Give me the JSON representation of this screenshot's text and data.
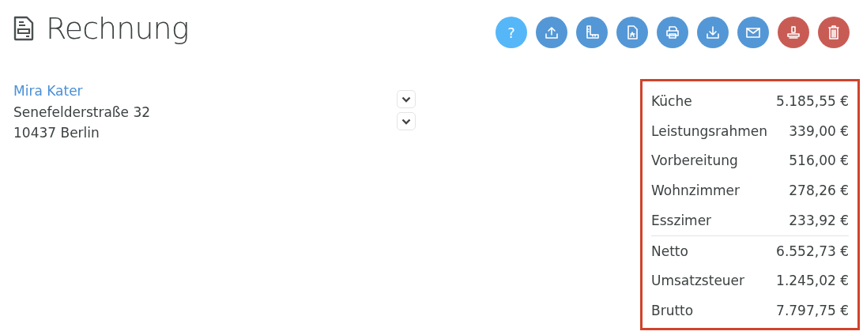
{
  "header": {
    "title": "Rechnung"
  },
  "toolbar": [
    {
      "kind": "help",
      "label": "?",
      "color": "#55b7f8"
    },
    {
      "kind": "upload",
      "color": "#5497d6"
    },
    {
      "kind": "measure",
      "color": "#5497d6"
    },
    {
      "kind": "pdf",
      "color": "#5497d6"
    },
    {
      "kind": "print",
      "color": "#5497d6"
    },
    {
      "kind": "download",
      "color": "#5497d6"
    },
    {
      "kind": "mail",
      "color": "#5497d6"
    },
    {
      "kind": "stamp",
      "color": "#c85c55"
    },
    {
      "kind": "delete",
      "color": "#c85c55"
    }
  ],
  "address": {
    "name": "Mira Kater",
    "street": "Senefelderstraße 32",
    "city": "10437 Berlin"
  },
  "summary": {
    "items": [
      {
        "label": "Küche",
        "amount": "5.185,55 €"
      },
      {
        "label": "Leistungsrahmen",
        "amount": "339,00 €"
      },
      {
        "label": "Vorbereitung",
        "amount": "516,00 €"
      },
      {
        "label": "Wohnzimmer",
        "amount": "278,26 €"
      },
      {
        "label": "Esszimer",
        "amount": "233,92 €"
      }
    ],
    "totals": [
      {
        "label": "Netto",
        "amount": "6.552,73 €"
      },
      {
        "label": "Umsatzsteuer",
        "amount": "1.245,02 €"
      },
      {
        "label": "Brutto",
        "amount": "7.797,75 €"
      }
    ]
  }
}
